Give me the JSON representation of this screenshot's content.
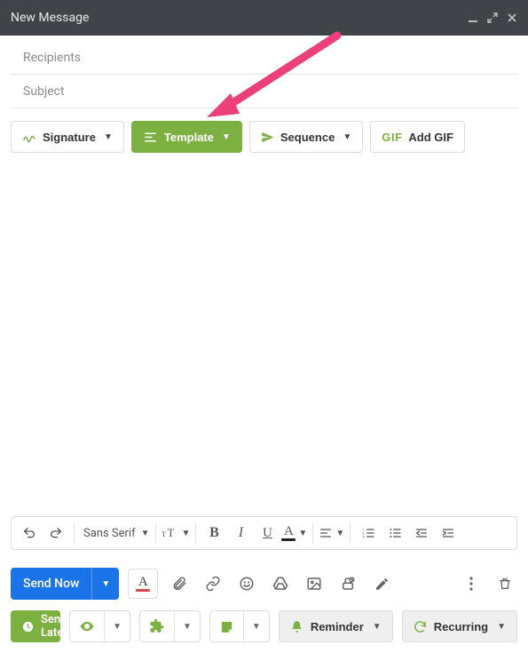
{
  "colors": {
    "accent_green": "#7cb141",
    "accent_blue": "#1a73e8",
    "titlebar_bg": "#404347",
    "arrow": "#ec407a"
  },
  "titlebar": {
    "title": "New Message"
  },
  "fields": {
    "recipients_placeholder": "Recipients",
    "subject_placeholder": "Subject"
  },
  "actions": {
    "signature": "Signature",
    "template": "Template",
    "sequence": "Sequence",
    "add_gif": "Add GIF",
    "gif_prefix": "GIF"
  },
  "format": {
    "font_family": "Sans Serif"
  },
  "bottom": {
    "send_now": "Send Now",
    "send_later": "Send Later",
    "reminder": "Reminder",
    "recurring": "Recurring"
  }
}
